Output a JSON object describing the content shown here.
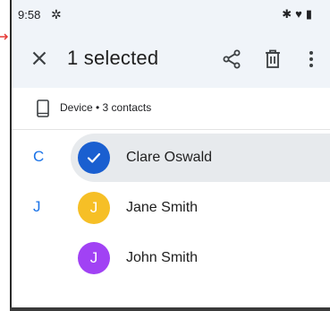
{
  "status_bar": {
    "time": "9:58",
    "settings_icon": "gear-icon",
    "right_icons": [
      "bluetooth-icon",
      "wifi-icon",
      "battery-icon"
    ]
  },
  "app_bar": {
    "title": "1 selected",
    "close_icon": "close-icon",
    "share_icon": "share-icon",
    "delete_icon": "trash-icon",
    "more_icon": "more-vert-icon"
  },
  "account": {
    "label": "Device • 3 contacts",
    "icon": "phone-device-icon"
  },
  "contacts": [
    {
      "section": "C",
      "initial": "",
      "name": "Clare Oswald",
      "selected": true,
      "avatar_color": "#1a5fd0"
    },
    {
      "section": "J",
      "initial": "J",
      "name": "Jane Smith",
      "selected": false,
      "avatar_color": "#f6bf26"
    },
    {
      "section": "",
      "initial": "J",
      "name": "John Smith",
      "selected": false,
      "avatar_color": "#a142f4"
    }
  ],
  "colors": {
    "header_bg": "#f0f4f9",
    "accent": "#1a73e8",
    "selection_bg": "#e7eaed"
  }
}
